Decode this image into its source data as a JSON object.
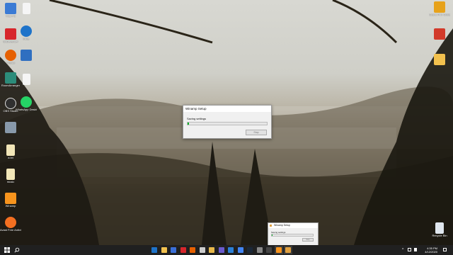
{
  "dialog": {
    "title": "Winamp Setup",
    "status": "Saving settings",
    "progress_fraction": 0.02,
    "stop_label": "Stop"
  },
  "mini_dialog": {
    "title": "Winamp Setup",
    "status": "Saving settings",
    "stop_label": "Stop"
  },
  "desktop": {
    "icons_left": [
      {
        "label": "This PC",
        "color": "#3b7bd4"
      },
      {
        "label": "BitDefender",
        "color": "#d7262b"
      },
      {
        "label": "Firefox",
        "color": "#e66000"
      },
      {
        "label": "RoomArranger",
        "color": "#2c8c7a"
      },
      {
        "label": "OBS Studio",
        "color": "#303030"
      },
      {
        "label": "",
        "color": "#8899aa"
      },
      {
        "label": "a.txt",
        "color": "#f2e6b8"
      },
      {
        "label": "music",
        "color": "#f2e6b8"
      },
      {
        "label": "Winamp",
        "color": "#f7941d"
      },
      {
        "label": "Avast Free Antivirus",
        "color": "#f36f21"
      }
    ],
    "icons_col2": [
      {
        "label": "",
        "color": "#f5f5f5"
      },
      {
        "label": "Edge",
        "color": "#1e73c9"
      },
      {
        "label": "",
        "color": "#2f6fc0"
      },
      {
        "label": "",
        "color": "#f5f5f5"
      },
      {
        "label": "WhatsApp Desktop",
        "color": "#25d366"
      }
    ],
    "icons_right": [
      {
        "label": "Grand Prix Global Edit.",
        "color": "#e7a21a"
      },
      {
        "label": "",
        "color": "#d23a2a"
      },
      {
        "label": "",
        "color": "#f2c14e"
      }
    ],
    "recycle_bin": "Recycle Bin"
  },
  "taskbar": {
    "time": "4:35 PM",
    "date": "4/12/2020",
    "apps": [
      {
        "name": "edge-icon",
        "color": "#1e73c9"
      },
      {
        "name": "explorer-icon",
        "color": "#f2c14e"
      },
      {
        "name": "store-icon",
        "color": "#3a6fd8"
      },
      {
        "name": "bitdefender-icon",
        "color": "#d7262b"
      },
      {
        "name": "firefox-icon",
        "color": "#e66000"
      },
      {
        "name": "settings-icon",
        "color": "#cccccc"
      },
      {
        "name": "folder-icon",
        "color": "#e7b84a"
      },
      {
        "name": "photos-icon",
        "color": "#6a5acd"
      },
      {
        "name": "app-icon",
        "color": "#2b7fd6"
      },
      {
        "name": "chrome-icon",
        "color": "#4285f4"
      },
      {
        "name": "steam-icon",
        "color": "#1b2838"
      },
      {
        "name": "clock-icon",
        "color": "#888888"
      },
      {
        "name": "app2-icon",
        "color": "#444444"
      },
      {
        "name": "winamp-icon",
        "color": "#f7941d"
      },
      {
        "name": "winamp-setup-icon",
        "color": "#e0a040"
      }
    ]
  }
}
